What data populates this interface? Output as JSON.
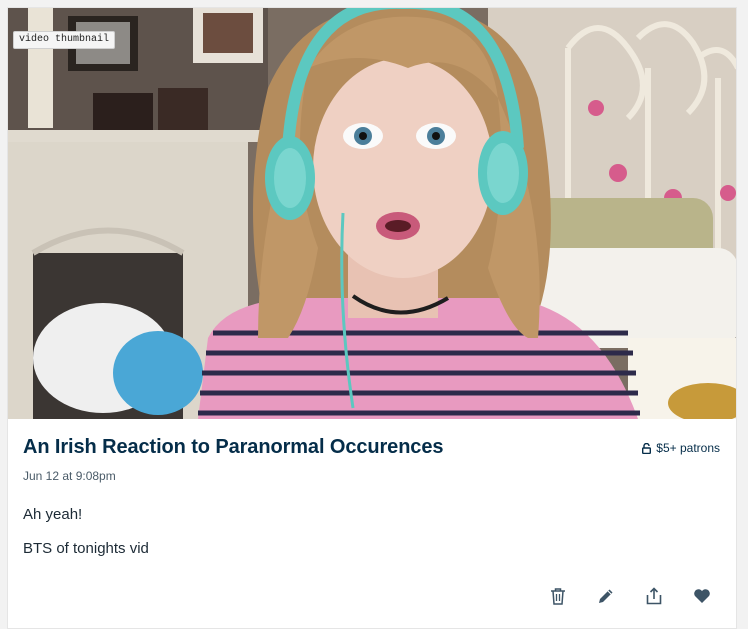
{
  "thumbnail": {
    "label": "video thumbnail"
  },
  "post": {
    "title": "An Irish Reaction to Paranormal Occurences",
    "date": "Jun 12 at 9:08pm",
    "access_label": "$5+ patrons",
    "body": [
      "Ah yeah!",
      "BTS of tonights vid"
    ]
  },
  "icons": {
    "access": "lock-open-icon",
    "delete": "trash-icon",
    "edit": "pencil-icon",
    "share": "share-icon",
    "like": "heart-icon"
  },
  "colors": {
    "title": "#052d49",
    "icon": "#3d5466",
    "headphones": "#5cc8c0",
    "stripes_pink": "#e89ac0"
  }
}
